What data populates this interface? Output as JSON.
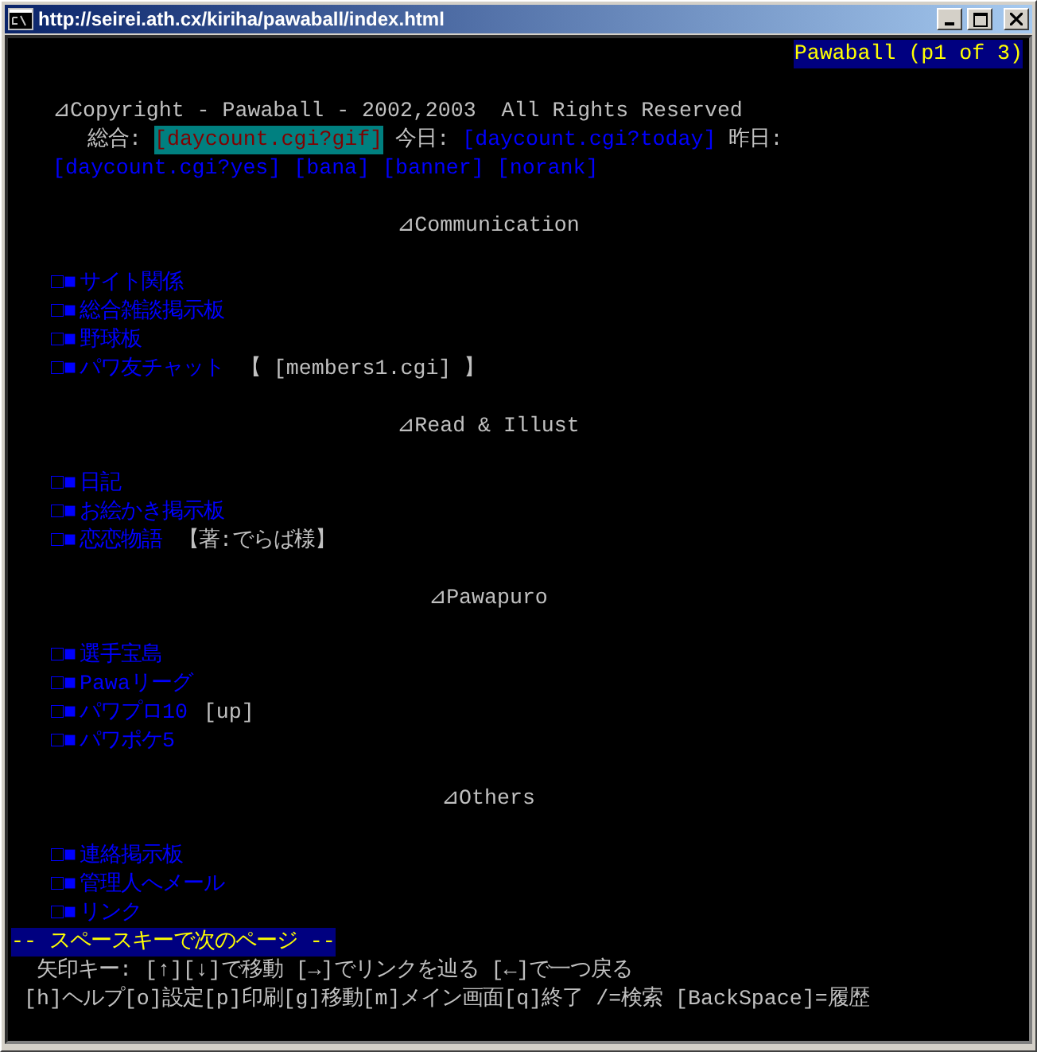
{
  "window": {
    "title": "http://seirei.ath.cx/kiriha/pawaball/index.html"
  },
  "page_status": "Pawaball (p1 of 3)",
  "copyright": "⊿Copyright - Pawaball - 2002,2003  All Rights Reserved",
  "counter_lines": [
    [
      {
        "kind": "label",
        "text": "総合:"
      },
      {
        "kind": "link",
        "text": "[daycount.cgi?gif]",
        "selected": true
      },
      {
        "kind": "label",
        "text": "今日:"
      },
      {
        "kind": "link",
        "text": "[daycount.cgi?today]",
        "selected": false
      },
      {
        "kind": "label",
        "text": "昨日:"
      }
    ],
    [
      {
        "kind": "link",
        "text": "[daycount.cgi?yes]",
        "selected": false
      },
      {
        "kind": "link",
        "text": "[bana]",
        "selected": false
      },
      {
        "kind": "link",
        "text": "[banner]",
        "selected": false
      },
      {
        "kind": "link",
        "text": "[norank]",
        "selected": false
      }
    ]
  ],
  "sections": [
    {
      "heading": "⊿Communication",
      "items": [
        {
          "bullet": "□■",
          "label": "サイト関係"
        },
        {
          "bullet": "□■",
          "label": "総合雑談掲示板"
        },
        {
          "bullet": "□■",
          "label": "野球板"
        },
        {
          "bullet": "□■",
          "label": "パワ友チャット",
          "note": "【 [members1.cgi] 】"
        }
      ]
    },
    {
      "heading": "⊿Read & Illust",
      "items": [
        {
          "bullet": "□■",
          "label": "日記"
        },
        {
          "bullet": "□■",
          "label": "お絵かき掲示板"
        },
        {
          "bullet": "□■",
          "label": "恋恋物語",
          "note": "【著:でらば様】"
        }
      ]
    },
    {
      "heading": "⊿Pawapuro",
      "items": [
        {
          "bullet": "□■",
          "label": "選手宝島"
        },
        {
          "bullet": "□■",
          "label": "Pawaリーグ"
        },
        {
          "bullet": "□■",
          "label": "パワプロ10",
          "note": "[up]"
        },
        {
          "bullet": "□■",
          "label": "パワポケ5"
        }
      ]
    },
    {
      "heading": "⊿Others",
      "items": [
        {
          "bullet": "□■",
          "label": "連絡掲示板"
        },
        {
          "bullet": "□■",
          "label": "管理人へメール"
        },
        {
          "bullet": "□■",
          "label": "リンク"
        }
      ]
    }
  ],
  "more_prompt": "-- スペースキーで次のページ --",
  "help_lines": [
    "矢印キー: [↑][↓]で移動 [→]でリンクを辿る [←]で一つ戻る",
    "[h]ヘルプ[o]設定[p]印刷[g]移動[m]メイン画面[q]終了 /=検索 [BackSpace]=履歴"
  ]
}
